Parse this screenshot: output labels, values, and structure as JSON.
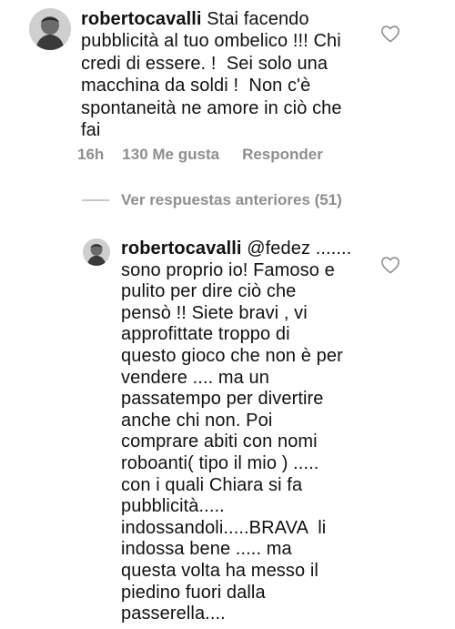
{
  "comments": [
    {
      "username": "robertocavalli",
      "lines": [
        "Stai facendo",
        "pubblicità al tuo ombelico !!! Chi",
        "credi di essere. !  Sei solo una",
        "macchina da soldi !  Non c'è",
        "spontaneità ne amore in ciò che",
        "fai"
      ],
      "time": "16h",
      "likes": "130 Me gusta",
      "reply": "Responder",
      "avatar_icon": "avatar-photo-icon",
      "like_icon": "heart-outline-icon"
    },
    {
      "username": "robertocavalli",
      "lines": [
        "@fedez .......",
        "sono proprio io! Famoso e",
        "pulito per dire ciò che",
        "pensò !! Siete bravi , vi",
        "approfittate troppo di",
        "questo gioco che non è per",
        "vendere .... ma un",
        "passatempo per divertire",
        "anche chi non. Poi",
        "comprare abiti con nomi",
        "roboanti( tipo il mio ) .....",
        "con i quali Chiara si fa",
        "pubblicità.....",
        "indossandoli.....BRAVA  li",
        "indossa bene ..... ma",
        "questa volta ha messo il",
        "piedino fuori dalla",
        "passerella...."
      ],
      "avatar_icon": "avatar-photo-icon",
      "like_icon": "heart-outline-icon"
    }
  ],
  "view_previous": "Ver respuestas anteriores (51)",
  "colors": {
    "text": "#111111",
    "secondary": "#8e8e8e",
    "divider": "#c7c7c7"
  }
}
